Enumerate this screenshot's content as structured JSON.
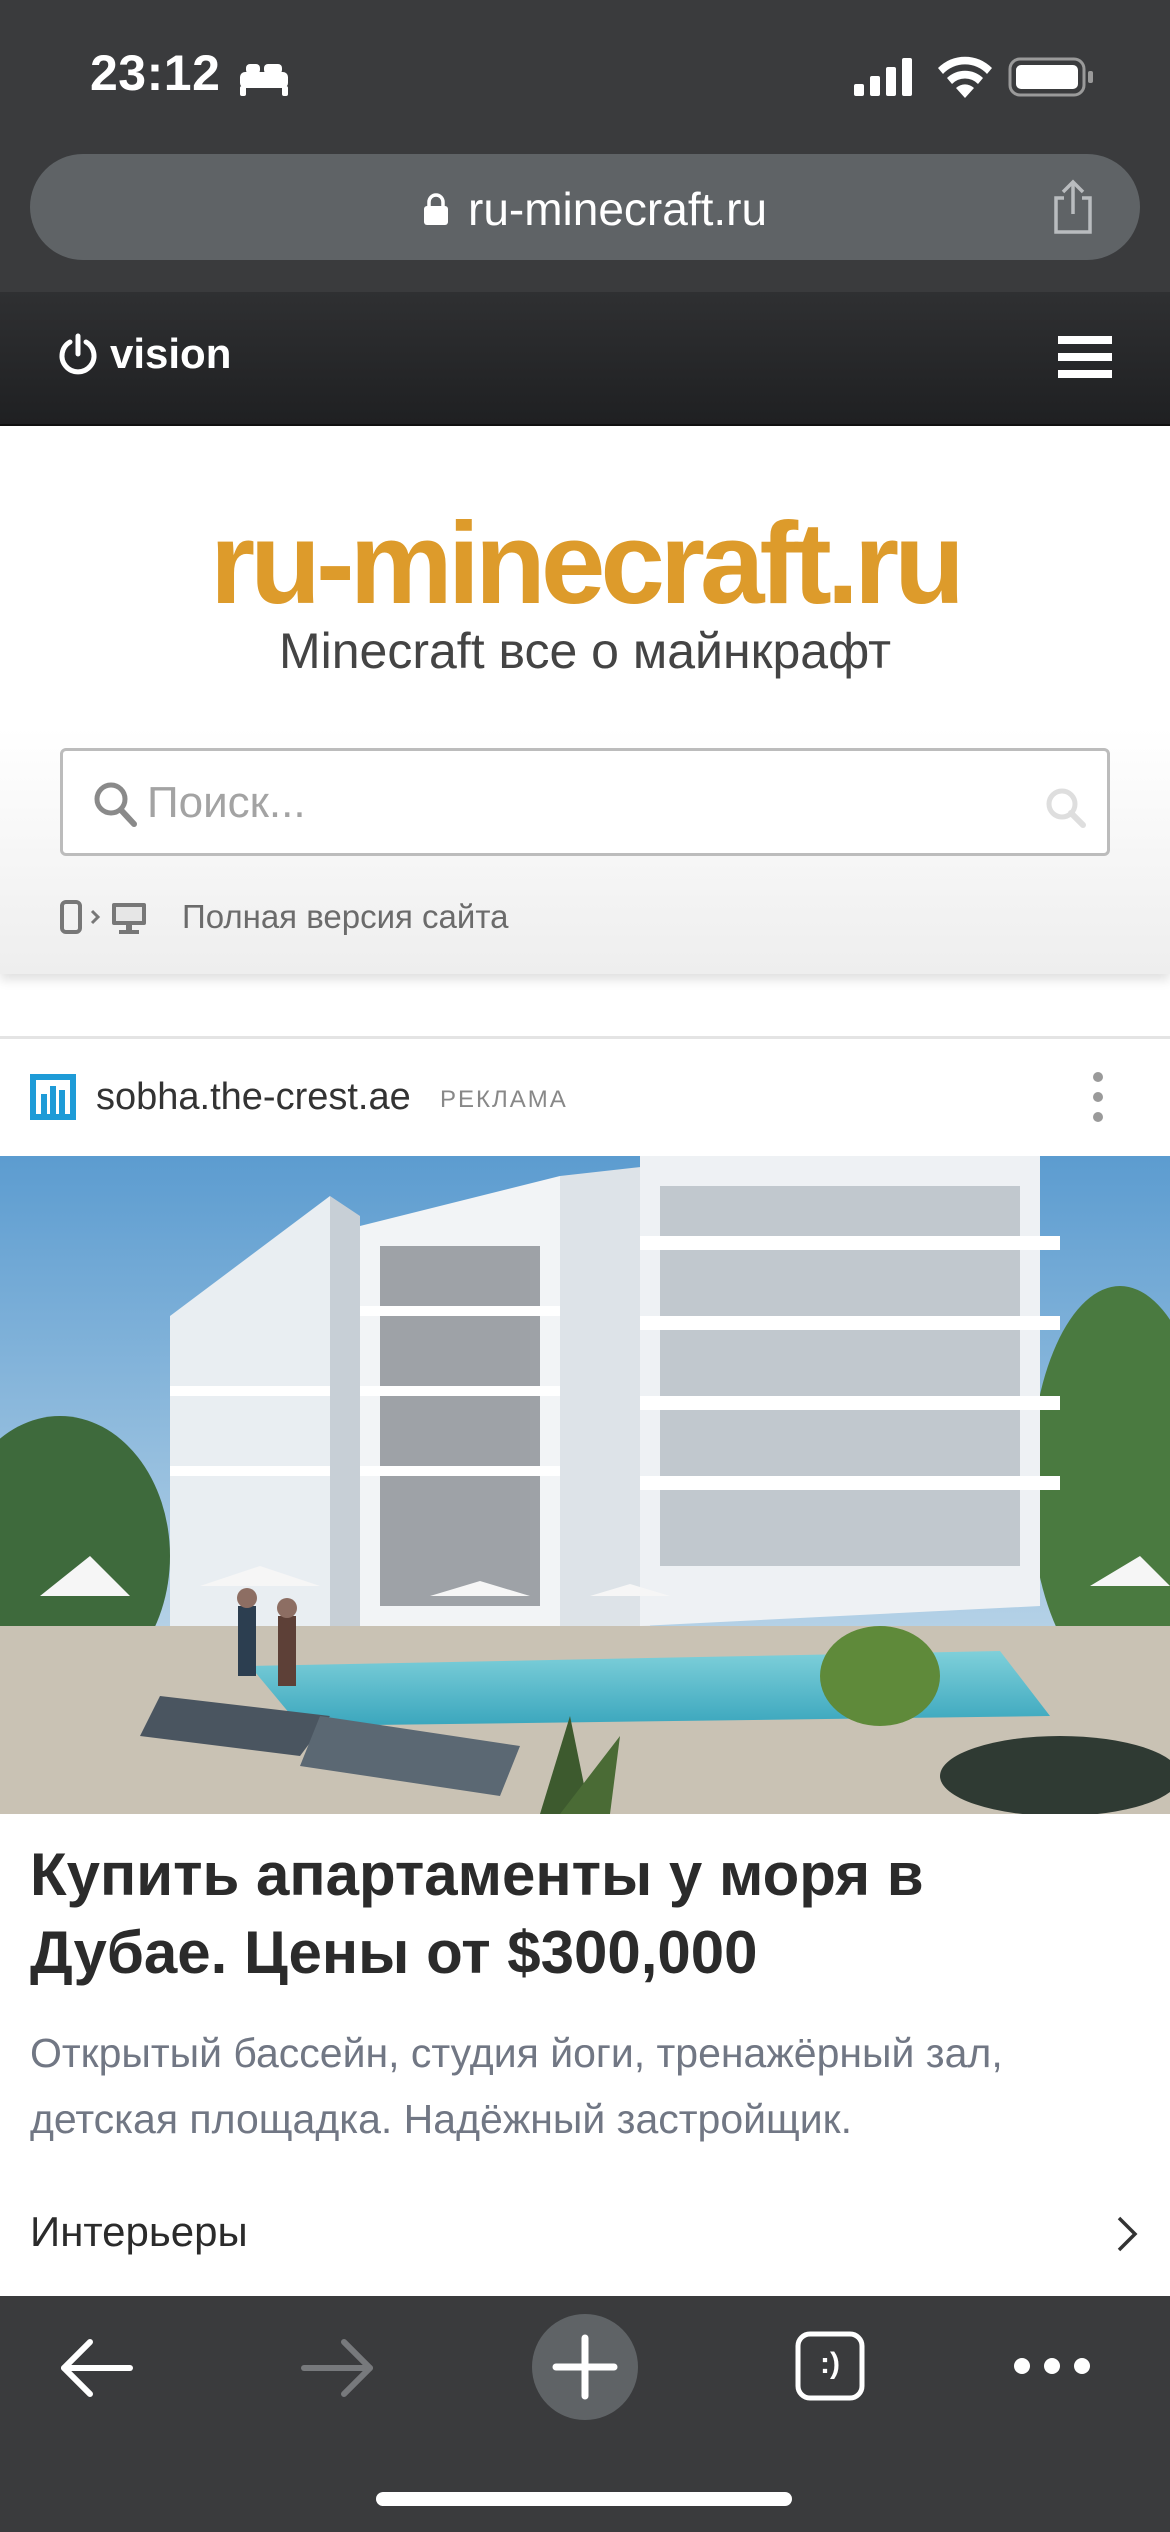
{
  "status_bar": {
    "time": "23:12"
  },
  "browser": {
    "url": "ru-minecraft.ru",
    "tab_count": ":)"
  },
  "nav": {
    "brand": "vision"
  },
  "header": {
    "logo": "ru-minecraft.ru",
    "tagline": "Minecraft все о майнкрафт",
    "search_placeholder": "Поиск...",
    "full_version": "Полная версия сайта"
  },
  "ad": {
    "domain": "sobha.the-crest.ae",
    "label": "РЕКЛАМА",
    "title": "Купить апартаменты у моря в Дубае. Цены от $300,000",
    "description": "Открытый бассейн, студия йоги, тренажёрный зал, детская площадка. Надёжный застройщик.",
    "link": "Интерьеры"
  },
  "colors": {
    "chrome": "#3a3b3d",
    "address_bar": "#5f6366",
    "logo": "#dd9b2b",
    "ad_favicon": "#1e9bd7"
  }
}
